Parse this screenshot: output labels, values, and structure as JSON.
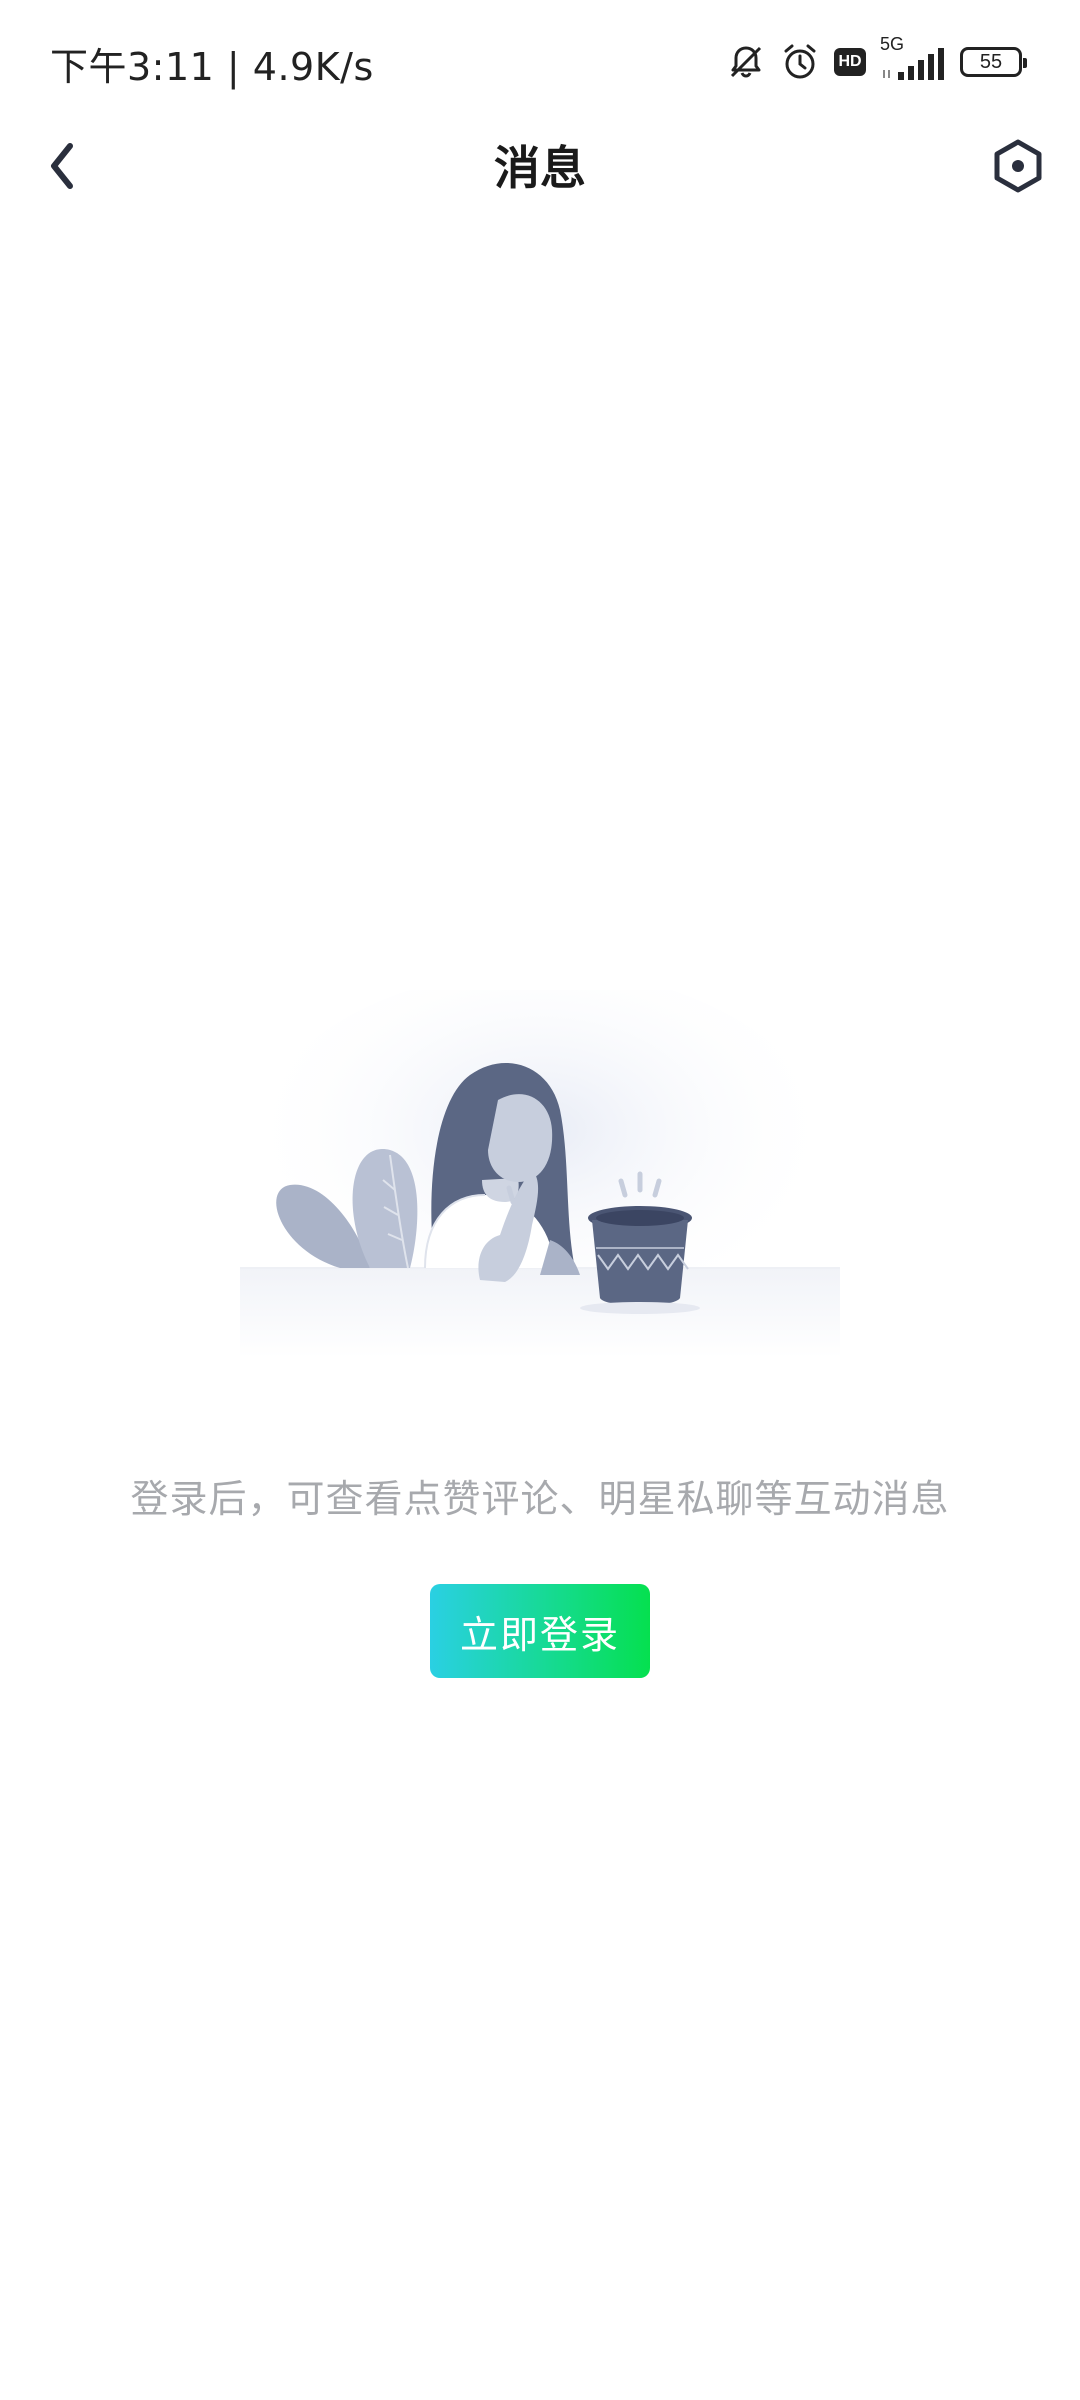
{
  "status_bar": {
    "time_speed": "下午3:11 | 4.9K/s",
    "network_label": "5G",
    "hd_label": "HD",
    "battery_level": "55"
  },
  "header": {
    "title": "消息",
    "back_icon": "chevron-left-icon",
    "settings_icon": "hexagon-settings-icon"
  },
  "empty_state": {
    "illustration": "girl-with-plant-pot-illustration",
    "hint": "登录后，可查看点赞评论、明星私聊等互动消息",
    "login_button_label": "立即登录"
  },
  "colors": {
    "title": "#1a1a1a",
    "hint": "#a7a9ad",
    "button_gradient_start": "#2ad0e3",
    "button_gradient_end": "#05e04f",
    "illustration_primary": "#5b6784",
    "illustration_light": "#aab3c8"
  }
}
